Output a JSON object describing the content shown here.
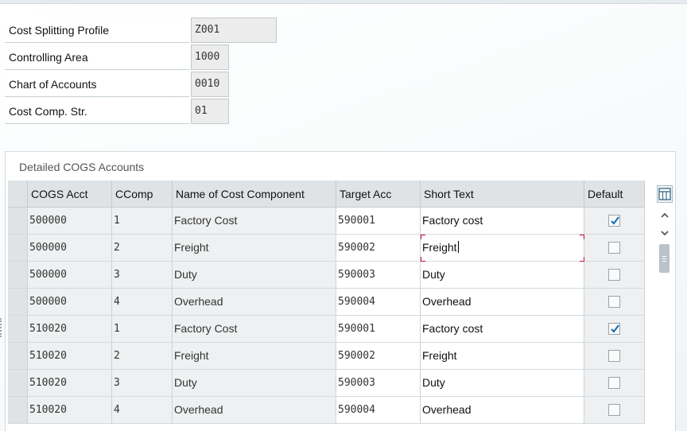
{
  "header_fields": [
    {
      "label": "Cost Splitting Profile",
      "value": "Z001"
    },
    {
      "label": "Controlling Area",
      "value": "1000"
    },
    {
      "label": "Chart of Accounts",
      "value": "0010"
    },
    {
      "label": "Cost Comp. Str.",
      "value": "01"
    }
  ],
  "table": {
    "title": "Detailed COGS Accounts",
    "columns": [
      "COGS Acct",
      "CComp",
      "Name of Cost Component",
      "Target Acc",
      "Short Text",
      "Default"
    ],
    "rows": [
      {
        "cogs_acct": "500000",
        "ccomp": "1",
        "name": "Factory Cost",
        "target_acc": "590001",
        "short_text": "Factory cost",
        "default": true
      },
      {
        "cogs_acct": "500000",
        "ccomp": "2",
        "name": "Freight",
        "target_acc": "590002",
        "short_text": "Freight",
        "default": false
      },
      {
        "cogs_acct": "500000",
        "ccomp": "3",
        "name": "Duty",
        "target_acc": "590003",
        "short_text": "Duty",
        "default": false
      },
      {
        "cogs_acct": "500000",
        "ccomp": "4",
        "name": "Overhead",
        "target_acc": "590004",
        "short_text": "Overhead",
        "default": false
      },
      {
        "cogs_acct": "510020",
        "ccomp": "1",
        "name": "Factory Cost",
        "target_acc": "590001",
        "short_text": "Factory cost",
        "default": true
      },
      {
        "cogs_acct": "510020",
        "ccomp": "2",
        "name": "Freight",
        "target_acc": "590002",
        "short_text": "Freight",
        "default": false
      },
      {
        "cogs_acct": "510020",
        "ccomp": "3",
        "name": "Duty",
        "target_acc": "590003",
        "short_text": "Duty",
        "default": false
      },
      {
        "cogs_acct": "510020",
        "ccomp": "4",
        "name": "Overhead",
        "target_acc": "590004",
        "short_text": "Overhead",
        "default": false
      }
    ],
    "focused_row": 1,
    "check_color": "#1a73b8"
  },
  "icons": {
    "settings": "table-settings-icon",
    "scroll_up": "chevron-up-icon",
    "scroll_down": "chevron-down-icon"
  }
}
